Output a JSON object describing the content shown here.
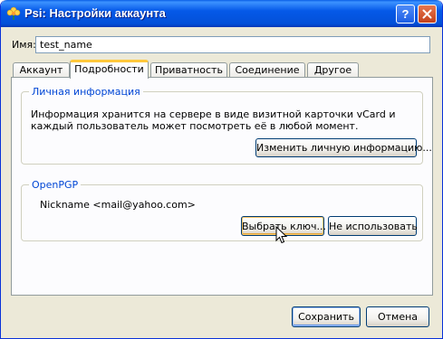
{
  "window": {
    "title": "Psi: Настройки аккаунта",
    "help_label": "?"
  },
  "name_field": {
    "label": "Имя:",
    "value": "test_name"
  },
  "tabs": [
    {
      "label": "Аккаунт",
      "active": false
    },
    {
      "label": "Подробности",
      "active": true
    },
    {
      "label": "Приватность",
      "active": false
    },
    {
      "label": "Соединение",
      "active": false
    },
    {
      "label": "Другое",
      "active": false
    }
  ],
  "personal_info": {
    "legend": "Личная информация",
    "text": "Информация хранится на сервере в виде визитной карточки vCard и каждый пользователь может посмотреть её в любой момент.",
    "edit_button": "Изменить личную информацию..."
  },
  "openpgp": {
    "legend": "OpenPGP",
    "key": "Nickname <mail@yahoo.com>",
    "select_button": "Выбрать ключ...",
    "no_use_button": "Не использовать"
  },
  "footer": {
    "save_button": "Сохранить",
    "cancel_button": "Отмена"
  },
  "icons": {
    "app": "psi-flower-icon",
    "help": "help-icon",
    "close": "close-icon",
    "cursor": "mouse-pointer-icon"
  },
  "colors": {
    "titlebar": "#0559e8",
    "dialog_bg": "#ece9d8",
    "panel_bg": "#fcfcfe",
    "legend_text": "#0046d5",
    "active_tab_accent": "#ffc83c",
    "close_button": "#c3411c"
  }
}
